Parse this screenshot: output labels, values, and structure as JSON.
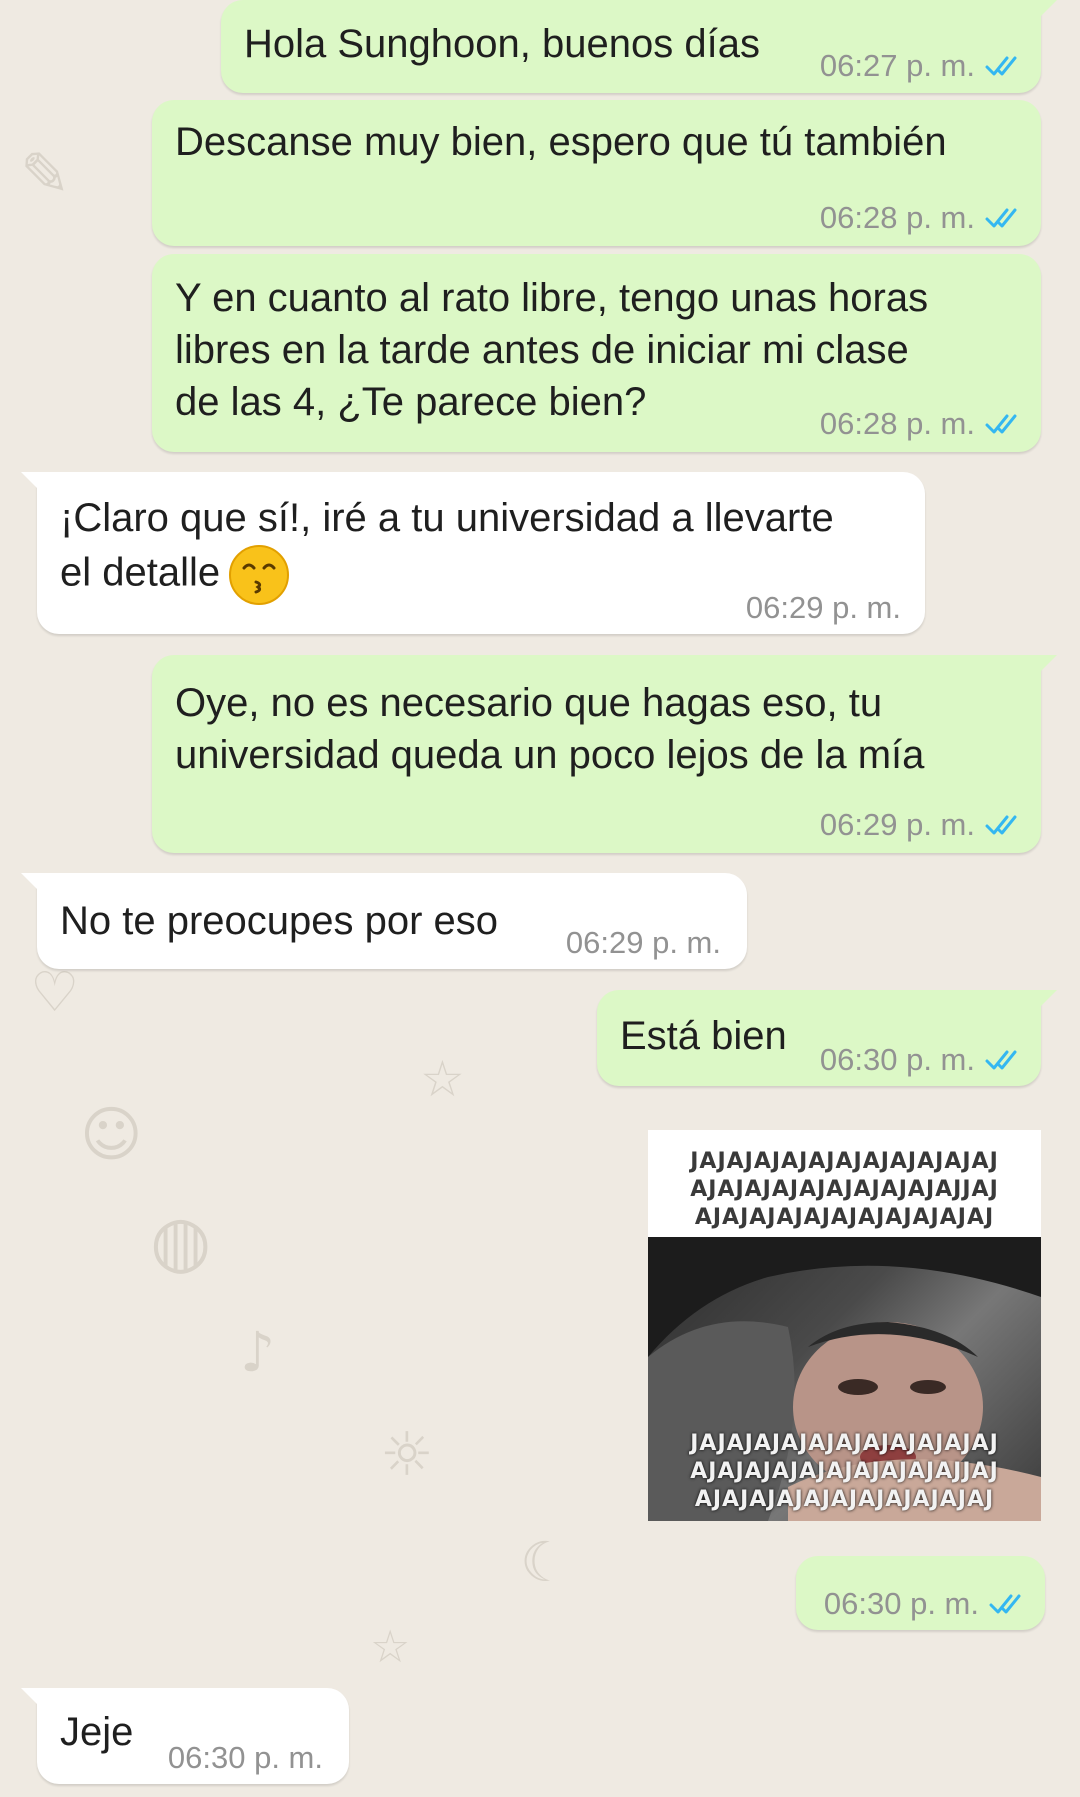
{
  "colors": {
    "outgoing_bubble": "#dcf8c6",
    "incoming_bubble": "#ffffff",
    "read_ticks": "#34b7f1",
    "background": "#efeae2"
  },
  "messages": [
    {
      "direction": "outgoing",
      "text": "Hola Sunghoon, buenos días",
      "time": "06:27 p. m.",
      "status": "read"
    },
    {
      "direction": "outgoing",
      "text": "Descanse muy bien, espero que tú también",
      "time": "06:28 p. m.",
      "status": "read"
    },
    {
      "direction": "outgoing",
      "text": "Y en cuanto al rato libre, tengo unas horas\nlibres en la tarde antes de iniciar mi clase\nde las 4, ¿Te parece bien?",
      "time": "06:28 p. m.",
      "status": "read"
    },
    {
      "direction": "incoming",
      "text": "¡Claro que sí!, iré a tu universidad a llevarte\nel detalle",
      "emoji": "kissing-face-with-smiling-eyes",
      "time": "06:29 p. m."
    },
    {
      "direction": "outgoing",
      "text": "Oye, no es necesario que hagas eso, tu\nuniversidad queda un poco lejos de la mía",
      "time": "06:29 p. m.",
      "status": "read"
    },
    {
      "direction": "incoming",
      "text": "No te preocupes por eso",
      "time": "06:29 p. m."
    },
    {
      "direction": "outgoing",
      "text": "Está bien",
      "time": "06:30 p. m.",
      "status": "read"
    },
    {
      "direction": "outgoing",
      "type": "image",
      "image_text_top": "JAJAJAJAJAJAJAJAJAJAJAJ\nAJAJAJAJAJAJAJAJAJAJJAJ\nAJAJAJAJAJAJAJAJAJAJAJ",
      "image_text_bottom": "JAJAJAJAJAJAJAJAJAJAJAJ\nAJAJAJAJAJAJAJAJAJAJJAJ\nAJAJAJAJAJAJAJAJAJAJAJ",
      "time": "06:30 p. m.",
      "status": "read"
    },
    {
      "direction": "incoming",
      "text": "Jeje",
      "time": "06:30 p. m."
    }
  ]
}
